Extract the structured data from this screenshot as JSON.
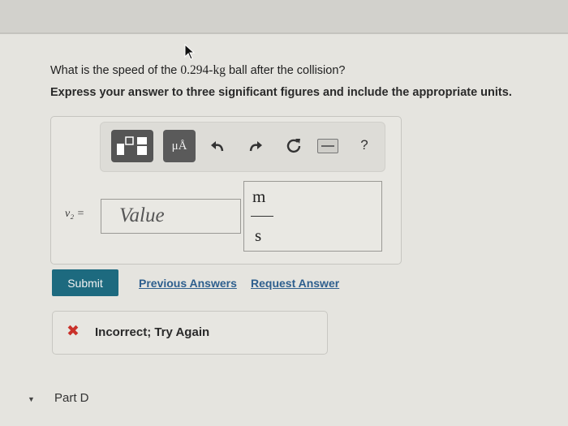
{
  "question": {
    "prefix": "What is the speed of the ",
    "mass": "0.294-kg",
    "suffix": " ball after the collision?"
  },
  "instruction": "Express your answer to three significant figures and include the appropriate units.",
  "toolbar": {
    "units_label": "μÅ",
    "help_label": "?",
    "icons": [
      "templates-icon",
      "units-icon",
      "undo-icon",
      "redo-icon",
      "reset-icon",
      "keyboard-icon",
      "help-icon"
    ]
  },
  "answer": {
    "variable_label": "v₂ =",
    "value_placeholder": "Value",
    "unit_numerator": "m",
    "unit_denominator": "s"
  },
  "actions": {
    "submit_label": "Submit",
    "previous_answers_label": "Previous Answers",
    "request_answer_label": "Request Answer"
  },
  "feedback": {
    "text": "Incorrect; Try Again",
    "status_color": "#c9312a"
  },
  "next_part": {
    "label": "Part D"
  },
  "colors": {
    "submit_bg": "#1d6a7f",
    "link": "#2e5f8e"
  }
}
